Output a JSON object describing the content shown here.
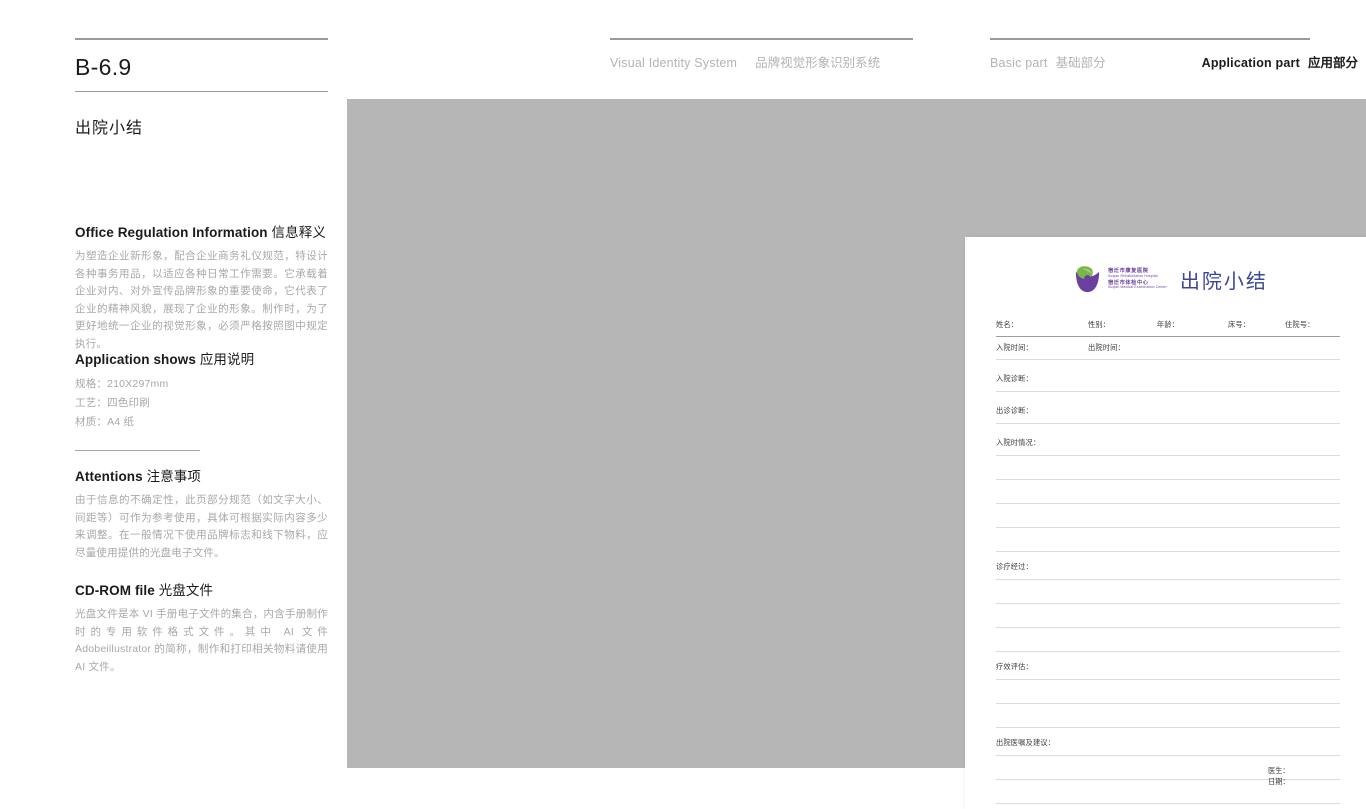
{
  "header": {
    "center": {
      "en": "Visual Identity System",
      "cn": "品牌视觉形象识别系统"
    },
    "right": {
      "basic_en": "Basic part",
      "basic_cn": "基础部分",
      "app_en": "Application part",
      "app_cn": "应用部分"
    }
  },
  "left": {
    "code": "B-6.9",
    "title": "出院小结",
    "sections": [
      {
        "head_en": "Office Regulation Information",
        "head_cn": "信息释义",
        "body": "为塑造企业新形象，配合企业商务礼仪规范，特设计各种事务用品，以适应各种日常工作需要。它承载着企业对内、对外宣传品牌形象的重要使命，它代表了企业的精神风貌，展现了企业的形象。制作时，为了更好地统一企业的视觉形象，必须严格按照图中规定执行。"
      },
      {
        "head_en": "Application shows",
        "head_cn": "应用说明",
        "specs": [
          "规格：210X297mm",
          "工艺：四色印刷",
          "材质：A4 纸"
        ]
      },
      {
        "head_en": "Attentions",
        "head_cn": "注意事项",
        "body": "由于信息的不确定性，此页部分规范（如文字大小、间距等）可作为参考使用，具体可根据实际内容多少来调整。在一般情况下使用品牌标志和线下物料，应尽量使用提供的光盘电子文件。"
      },
      {
        "head_en": "CD-ROM file",
        "head_cn": "光盘文件",
        "body": "光盘文件是本 VI 手册电子文件的集合，内含手册制作时的专用软件格式文件。其中 AI 文件 Adobeillustrator 的简称，制作和打印相关物料请使用 AI 文件。"
      }
    ]
  },
  "document": {
    "logo": {
      "line1_cn": "宿迁市康复医院",
      "line1_en": "Suqian Rehabilitation Hospital",
      "line2_cn": "宿迁市体检中心",
      "line2_en": "Suqian Medical Examination Center",
      "purple": "#6b3fa0",
      "green": "#7ab648"
    },
    "title": "出院小结",
    "title_color": "#3c4896",
    "fields": {
      "name": "姓名：",
      "gender": "性别：",
      "age": "年龄：",
      "bed": "床号：",
      "admission_no": "住院号：",
      "admit_time": "入院时间：",
      "discharge_time": "出院时间：",
      "admit_diagnosis": "入院诊断：",
      "visit_diagnosis": "出诊诊断：",
      "admit_condition": "入院时情况：",
      "treatment_course": "诊疗经过：",
      "effect_eval": "疗效评估：",
      "discharge_advice": "出院医嘱及建议："
    },
    "signature": {
      "doctor": "医生：",
      "date": "日期："
    }
  },
  "colors": {
    "stage_gray": "#b6b6b6",
    "rule_gray": "#9a9a9a",
    "body_gray": "#a8a8a8"
  }
}
